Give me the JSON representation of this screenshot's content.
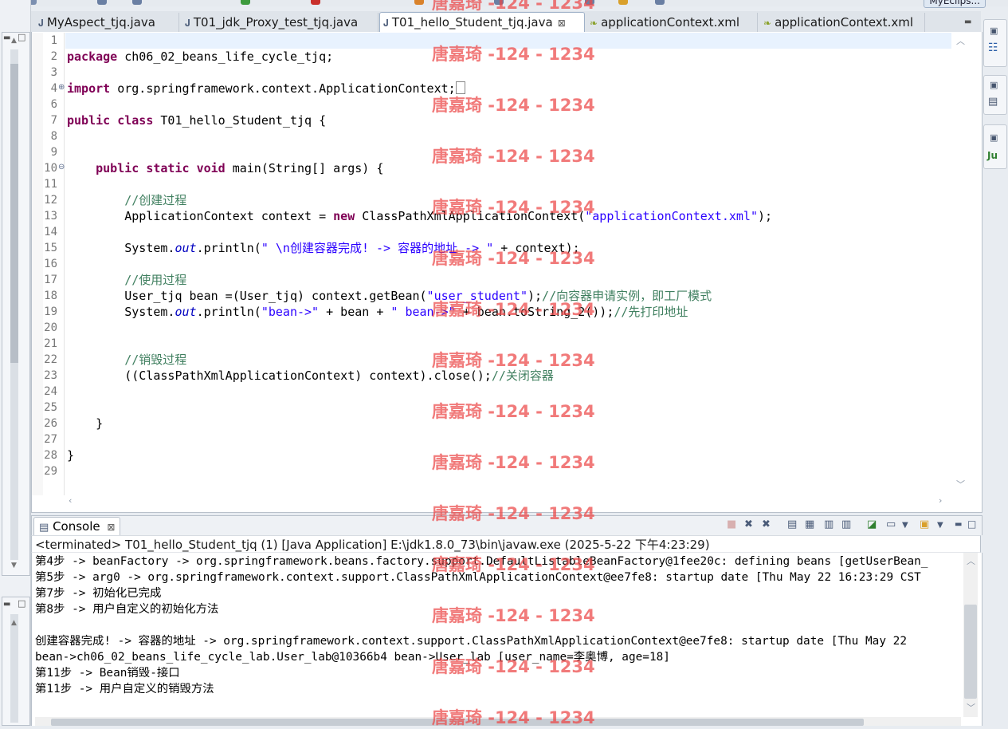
{
  "window": {
    "perspective_label": "MyEclips..."
  },
  "editor": {
    "tabs": [
      {
        "label": "MyAspect_tjq.java",
        "icon": "java-file-icon"
      },
      {
        "label": "T01_jdk_Proxy_test_tjq.java",
        "icon": "java-file-icon"
      },
      {
        "label": "T01_hello_Student_tjq.java",
        "icon": "java-file-icon",
        "active": true
      },
      {
        "label": "applicationContext.xml",
        "icon": "xml-file-icon"
      },
      {
        "label": "applicationContext.xml",
        "icon": "xml-file-icon"
      }
    ],
    "close_glyph": "⊠",
    "line_numbers": [
      "1",
      "2",
      "3",
      "4",
      "6",
      "7",
      "8",
      "9",
      "10",
      "11",
      "12",
      "13",
      "14",
      "15",
      "16",
      "17",
      "18",
      "19",
      "20",
      "21",
      "22",
      "23",
      "24",
      "25",
      "26",
      "27",
      "28",
      "29"
    ],
    "code": {
      "l2_kw": "package",
      "l2_rest": " ch06_02_beans_life_cycle_tjq;",
      "l4_kw": "import",
      "l4_rest": " org.springframework.context.ApplicationContext;",
      "l7_kw1": "public",
      "l7_kw2": "class",
      "l7_rest": " T01_hello_Student_tjq {",
      "l10_kw1": "public",
      "l10_kw2": "static",
      "l10_kw3": "void",
      "l10_rest": " main(String[] args) {",
      "l12_cm": "//创建过程",
      "l13_a": "ApplicationContext context = ",
      "l13_kw": "new",
      "l13_b": " ClassPathXmlApplicationContext(",
      "l13_str": "\"applicationContext.xml\"",
      "l13_c": ");",
      "l15_a": "System.",
      "l15_it": "out",
      "l15_b": ".println(",
      "l15_str": "\" \\n创建容器完成! -> 容器的地址 -> \"",
      "l15_c": " + context);",
      "l17_cm": "//使用过程",
      "l18_a": "User_tjq bean =(User_tjq) context.getBean(",
      "l18_str": "\"user_student\"",
      "l18_b": ");",
      "l18_cm": "//向容器申请实例，即工厂模式",
      "l19_a": "System.",
      "l19_it": "out",
      "l19_b": ".println(",
      "l19_str1": "\"bean->\"",
      "l19_c": " + bean + ",
      "l19_str2": "\" bean->\"",
      "l19_d": " + bean.toString_2());",
      "l19_cm": "//先打印地址",
      "l22_cm": "//销毁过程",
      "l23_a": "((ClassPathXmlApplicationContext) context).close();",
      "l23_cm": "//关闭容器",
      "l26": "}",
      "l28": "}"
    }
  },
  "console": {
    "tab_label": "Console",
    "description": "<terminated> T01_hello_Student_tjq (1) [Java Application] E:\\jdk1.8.0_73\\bin\\javaw.exe (2025-5-22 下午4:23:29)",
    "lines": [
      "第4步 -> beanFactory -> org.springframework.beans.factory.support.DefaultListableBeanFactory@1fee20c: defining beans [getUserBean_",
      "第5步 -> arg0 -> org.springframework.context.support.ClassPathXmlApplicationContext@ee7fe8: startup date [Thu May 22 16:23:29 CST",
      "第7步 -> 初始化已完成",
      "第8步 -> 用户自定义的初始化方法",
      "",
      "创建容器完成! -> 容器的地址 -> org.springframework.context.support.ClassPathXmlApplicationContext@ee7fe8: startup date [Thu May 22",
      "bean->ch06_02_beans_life_cycle_lab.User_lab@10366b4 bean->User_lab [user_name=李奥博, age=18]",
      "第11步 -> Bean销毁-接口",
      "第11步 -> 用户自定义的销毁方法"
    ]
  },
  "watermark": "唐嘉琦 -124 - 1234",
  "colors": {
    "keyword": "#7f0055",
    "string": "#2a00ff",
    "comment": "#3f7f5f",
    "static_field": "#0000c0",
    "watermark": "#ec4646"
  }
}
